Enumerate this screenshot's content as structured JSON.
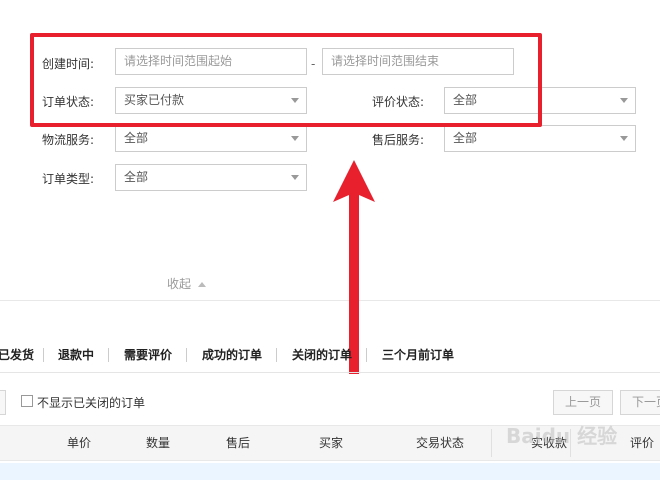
{
  "filters": {
    "created_time_label": "创建时间:",
    "created_start_placeholder": "请选择时间范围起始",
    "created_dash": "-",
    "created_end_placeholder": "请选择时间范围结束",
    "order_status_label": "订单状态:",
    "order_status_value": "买家已付款",
    "review_status_label": "评价状态:",
    "review_status_value": "全部",
    "logistics_label": "物流服务:",
    "logistics_value": "全部",
    "aftersale_label": "售后服务:",
    "aftersale_value": "全部",
    "order_type_label": "订单类型:",
    "order_type_value": "全部",
    "collapse_label": "收起"
  },
  "tabs": [
    "已发货",
    "退款中",
    "需要评价",
    "成功的订单",
    "关闭的订单",
    "三个月前订单"
  ],
  "list_controls": {
    "hide_closed_label": "不显示已关闭的订单",
    "prev_page": "上一页",
    "next_page": "下一页"
  },
  "table_header": [
    "单价",
    "数量",
    "售后",
    "买家",
    "交易状态",
    "实收款",
    "评价"
  ],
  "watermark": "Baidu 经验",
  "colors": {
    "highlight_red": "#e8202e",
    "arrow_red": "#e8202e",
    "border_gray": "#cccccc",
    "header_bg": "#f5f5f5",
    "row_highlight": "#eaf5ff"
  }
}
